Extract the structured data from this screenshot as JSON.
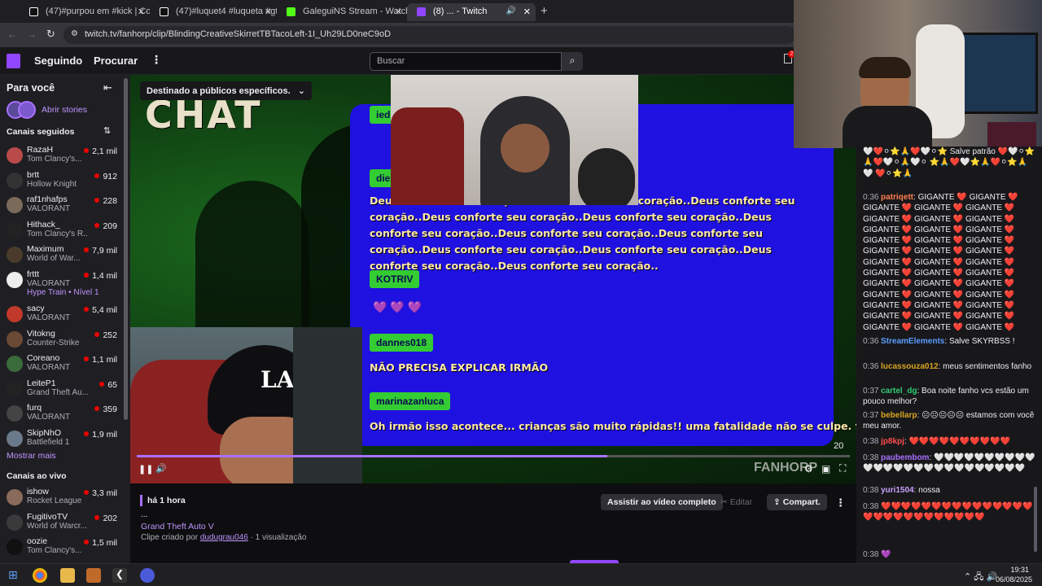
{
  "browser": {
    "tabs": [
      {
        "title": "(47)#purpou em #kick | Com a",
        "icon": "tiktok-icon"
      },
      {
        "title": "(47)#luquet4 #luqueta #gtarp |",
        "icon": "tiktok-icon"
      },
      {
        "title": "GaleguiNS Stream - Watch Live",
        "icon": "kick-icon"
      },
      {
        "title": "(8) ... - Twitch",
        "icon": "twitch-icon"
      }
    ],
    "url": "twitch.tv/fanhorp/clip/BlindingCreativeSkirretTBTacoLeft-1I_Uh29LD0neC9oD"
  },
  "twitch": {
    "nav": {
      "following": "Seguindo",
      "browse": "Procurar",
      "search_placeholder": "Buscar",
      "notif_badge": "2"
    },
    "sidebar": {
      "for_you": "Para você",
      "stories": "Abrir stories",
      "followed_header": "Canais seguidos",
      "followed": [
        {
          "name": "RazaH",
          "game": "Tom Clancy's...",
          "viewers": "2,1 mil",
          "color": "#b94a4a"
        },
        {
          "name": "brtt",
          "game": "Hollow Knight",
          "viewers": "912",
          "color": "#333"
        },
        {
          "name": "raf1nhafps",
          "game": "VALORANT",
          "viewers": "228",
          "color": "#7a6a5a"
        },
        {
          "name": "Hithack_",
          "game": "Tom Clancy's R...",
          "viewers": "209",
          "color": "#222"
        },
        {
          "name": "Maximum",
          "game": "World of War...",
          "viewers": "7,9 mil",
          "color": "#4a3b2a"
        },
        {
          "name": "frttt",
          "game": "VALORANT",
          "viewers": "1,4 mil",
          "color": "#eeeeee"
        },
        {
          "name": "sacy",
          "game": "VALORANT",
          "viewers": "5,4 mil",
          "color": "#c0392b"
        },
        {
          "name": "Vitokng",
          "game": "Counter-Strike",
          "viewers": "252",
          "color": "#6b4a35"
        },
        {
          "name": "Coreano",
          "game": "VALORANT",
          "viewers": "1,1 mil",
          "color": "#3a6b3a"
        },
        {
          "name": "LeiteP1",
          "game": "Grand Theft Au...",
          "viewers": "65",
          "color": "#222"
        },
        {
          "name": "furq",
          "game": "VALORANT",
          "viewers": "359",
          "color": "#444"
        },
        {
          "name": "SkipNhO",
          "game": "Battlefield 1",
          "viewers": "1,9 mil",
          "color": "#6b7a8a"
        }
      ],
      "hype_train": "Hype Train • Nível 1",
      "show_more": "Mostrar mais",
      "live_header": "Canais ao vivo",
      "live": [
        {
          "name": "ishow",
          "game": "Rocket League",
          "viewers": "3,3 mil",
          "color": "#8a6a5a"
        },
        {
          "name": "FugitivoTV",
          "game": "World of Warcr...",
          "viewers": "202",
          "color": "#3a3a3a"
        },
        {
          "name": "oozie",
          "game": "Tom Clancy's...",
          "viewers": "1,5 mil",
          "color": "#111"
        }
      ]
    },
    "player": {
      "audience_label": "Destinado a públicos específicos.",
      "overlay_title": "CHAT",
      "chat_overlay": [
        {
          "user": "ied",
          "text": ""
        },
        {
          "user": "die",
          "text": "Deus conforte seu coração..Deus conforte seu coração..Deus conforte seu coração..Deus conforte seu coração..Deus conforte seu coração..Deus conforte seu coração..Deus conforte seu coração..Deus conforte seu coração..Deus conforte seu coração..Deus conforte seu coração..Deus conforte seu coração..Deus conforte seu coração.."
        },
        {
          "user": "KOTRIV",
          "text": "💜 💜 💜"
        },
        {
          "user": "dannes018",
          "text": "NÃO PRECISA EXPLICAR IRMÃO"
        },
        {
          "user": "marinazanluca",
          "text": "Oh irmão isso acontece... crianças são muito rápidas!! uma fatalidade não se culpe. força"
        }
      ],
      "watermark": "FANHORP",
      "time_left": "20",
      "progress": 0.66
    },
    "below": {
      "age": "há 1 hora",
      "dots": "...",
      "game": "Grand Theft Auto V",
      "clip_by_prefix": "Clipe criado por",
      "clip_by_user": "dudugrau046",
      "views": "· 1 visualização",
      "watch_full": "Assistir ao vídeo completo",
      "edit": "Editar",
      "share": "Compart."
    },
    "chat": [
      {
        "time": "",
        "user": "",
        "color": "#efeff1",
        "text": "🤍❤️⚪⭐🙏❤️🤍⚪⭐ Salve patrão ❤️🤍⚪⭐🙏❤️🤍⚪🙏🤍⚪ ⭐🙏❤️🤍⭐🙏❤️⚪⭐🙏🤍 ❤️⚪⭐🙏"
      },
      {
        "time": "0:36",
        "user": "patriqett",
        "color": "#ff7f50",
        "text": "GIGANTE ❤️ GIGANTE ❤️ GIGANTE ❤️ GIGANTE ❤️ GIGANTE ❤️ GIGANTE ❤️ GIGANTE ❤️ GIGANTE ❤️ GIGANTE ❤️ GIGANTE ❤️ GIGANTE ❤️ GIGANTE ❤️ GIGANTE ❤️ GIGANTE ❤️ GIGANTE ❤️ GIGANTE ❤️ GIGANTE ❤️ GIGANTE ❤️ GIGANTE ❤️ GIGANTE ❤️ GIGANTE ❤️ GIGANTE ❤️ GIGANTE ❤️ GIGANTE ❤️ GIGANTE ❤️ GIGANTE ❤️ GIGANTE ❤️ GIGANTE ❤️ GIGANTE ❤️ GIGANTE ❤️ GIGANTE ❤️ GIGANTE ❤️ GIGANTE ❤️ GIGANTE ❤️ GIGANTE ❤️ GIGANTE ❤️ GIGANTE ❤️ GIGANTE ❤️ GIGANTE ❤️ GIGANTE ❤️ GIGANTE ❤️ GIGANTE ❤️ GIGANTE ❤️ GIGANTE ❤️ GIGANTE ❤️ GIGANTE ❤️ GIGANTE ❤️ GIGANTE ❤️ GIGANTE ❤️"
      },
      {
        "time": "0:36",
        "user": "StreamElements",
        "color": "#5b9bff",
        "text": "Salve SKYRBSS !"
      },
      {
        "time": "0:36",
        "user": "lucassouza012",
        "color": "#daa520",
        "text": "meus sentimentos fanho"
      },
      {
        "time": "0:37",
        "user": "cartel_dg",
        "color": "#2ecc71",
        "text": "Boa noite fanho vcs estão um pouco melhor?"
      },
      {
        "time": "0:37",
        "user": "bebellarp",
        "color": "#daa520",
        "text": "😐😐😐😐😐 estamos com você meu amor."
      },
      {
        "time": "0:38",
        "user": "jp8kpj",
        "color": "#ff4d4d",
        "text": "❤️❤️❤️❤️❤️❤️❤️❤️❤️❤️"
      },
      {
        "time": "0:38",
        "user": "paubembom",
        "color": "#a970ff",
        "text": "🤍🤍🤍🤍🤍🤍🤍🤍🤍🤍🤍🤍🤍🤍🤍🤍🤍🤍🤍🤍🤍🤍🤍🤍🤍🤍"
      },
      {
        "time": "0:38",
        "user": "yuri1504",
        "color": "#c9a0ff",
        "text": "nossa"
      },
      {
        "time": "0:38",
        "user": "",
        "color": "#1e90ff",
        "text": "❤️❤️❤️❤️❤️❤️❤️❤️❤️❤️❤️❤️❤️❤️❤️❤️❤️❤️❤️❤️❤️❤️❤️❤️❤️❤️❤️"
      },
      {
        "time": "0:38",
        "user": "",
        "color": "#1e90ff",
        "text": "💜"
      }
    ]
  },
  "taskbar": {
    "time": "19:31",
    "date": "06/08/2025"
  },
  "colors": {
    "twitch": "#9146ff",
    "overlay_blue": "#1f11e0",
    "overlay_green": "#33cc33"
  }
}
